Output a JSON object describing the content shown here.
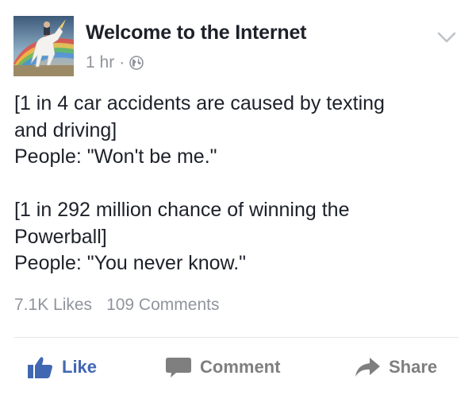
{
  "post": {
    "page_name": "Welcome to the Internet",
    "timestamp": "1 hr",
    "separator": "·",
    "privacy_icon": "globe-icon",
    "menu_icon": "chevron-down-icon",
    "avatar_icon": "unicorn-avatar",
    "text_lines": [
      "[1 in 4 car accidents are caused by texting",
      "and driving]",
      "People: \"Won't be me.\"",
      "",
      "[1 in 292 million chance of winning the",
      "Powerball]",
      "People: \"You never know.\""
    ]
  },
  "engagement": {
    "likes": "7.1K Likes",
    "comments": "109 Comments"
  },
  "actions": {
    "like_label": "Like",
    "comment_label": "Comment",
    "share_label": "Share"
  },
  "colors": {
    "text": "#1d2129",
    "meta": "#90949c",
    "like_blue": "#4267b2",
    "action_gray": "#7f7f7f",
    "divider": "#e5e6e9"
  }
}
